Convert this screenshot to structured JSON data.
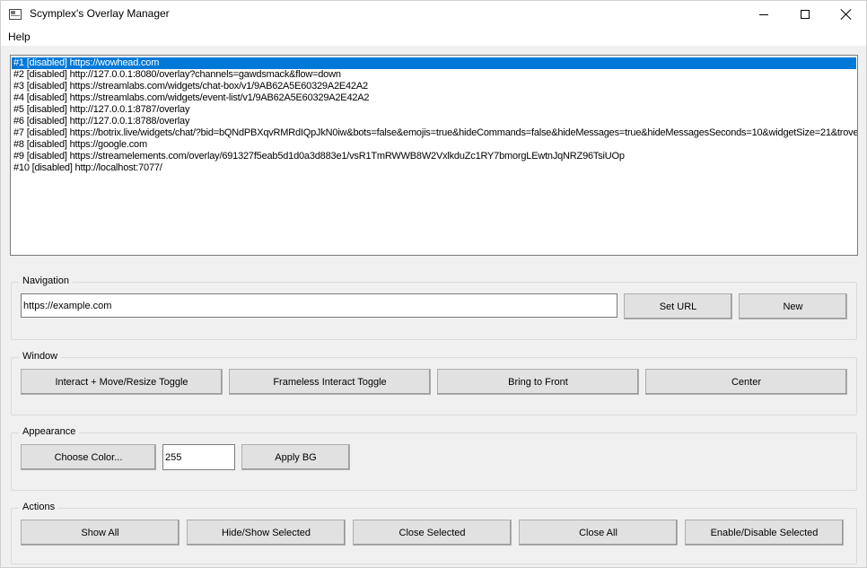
{
  "titlebar": {
    "title": "Scymplex's Overlay Manager",
    "icon": "app-window-icon"
  },
  "menubar": {
    "items": [
      {
        "label": "Help"
      }
    ]
  },
  "overlay_list": {
    "selected_index": 0,
    "items": [
      {
        "label": "#1  [disabled] https://wowhead.com"
      },
      {
        "label": "#2  [disabled] http://127.0.0.1:8080/overlay?channels=gawdsmack&flow=down"
      },
      {
        "label": "#3  [disabled] https://streamlabs.com/widgets/chat-box/v1/9AB62A5E60329A2E42A2"
      },
      {
        "label": "#4  [disabled] https://streamlabs.com/widgets/event-list/v1/9AB62A5E60329A2E42A2"
      },
      {
        "label": "#5  [disabled] http://127.0.0.1:8787/overlay"
      },
      {
        "label": "#6  [disabled] http://127.0.0.1:8788/overlay"
      },
      {
        "label": "#7  [disabled] https://botrix.live/widgets/chat/?bid=bQNdPBXqvRMRdIQpJkN0iw&bots=false&emojis=true&hideCommands=false&hideMessages=true&hideMessagesSeconds=10&widgetSize=21&trove"
      },
      {
        "label": "#8  [disabled] https://google.com"
      },
      {
        "label": "#9  [disabled] https://streamelements.com/overlay/691327f5eab5d1d0a3d883e1/vsR1TmRWWB8W2VxlkduZc1RY7bmorgLEwtnJqNRZ96TsiUOp"
      },
      {
        "label": "#10  [disabled] http://localhost:7077/"
      }
    ]
  },
  "navigation": {
    "legend": "Navigation",
    "url_value": "https://example.com",
    "set_url_label": "Set URL",
    "new_label": "New"
  },
  "window_group": {
    "legend": "Window",
    "interact_toggle_label": "Interact + Move/Resize Toggle",
    "frameless_toggle_label": "Frameless Interact Toggle",
    "bring_front_label": "Bring to Front",
    "center_label": "Center"
  },
  "appearance": {
    "legend": "Appearance",
    "choose_color_label": "Choose Color...",
    "alpha_value": "255",
    "apply_bg_label": "Apply BG"
  },
  "actions": {
    "legend": "Actions",
    "show_all_label": "Show All",
    "hide_show_label": "Hide/Show Selected",
    "close_selected_label": "Close Selected",
    "close_all_label": "Close All",
    "enable_disable_label": "Enable/Disable Selected"
  },
  "colors": {
    "selection": "#0078d7",
    "window_bg": "#f0f0f0",
    "button_face": "#e1e1e1"
  }
}
